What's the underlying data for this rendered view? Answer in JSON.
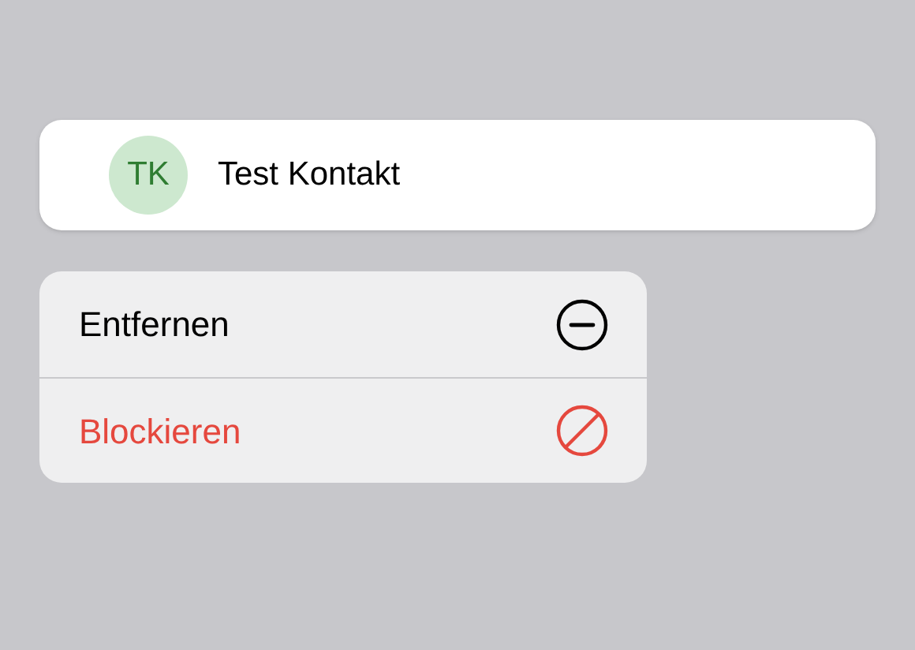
{
  "contact": {
    "initials": "TK",
    "name": "Test Kontakt"
  },
  "menu": [
    {
      "label": "Entfernen",
      "kind": "normal"
    },
    {
      "label": "Blockieren",
      "kind": "destructive"
    }
  ]
}
